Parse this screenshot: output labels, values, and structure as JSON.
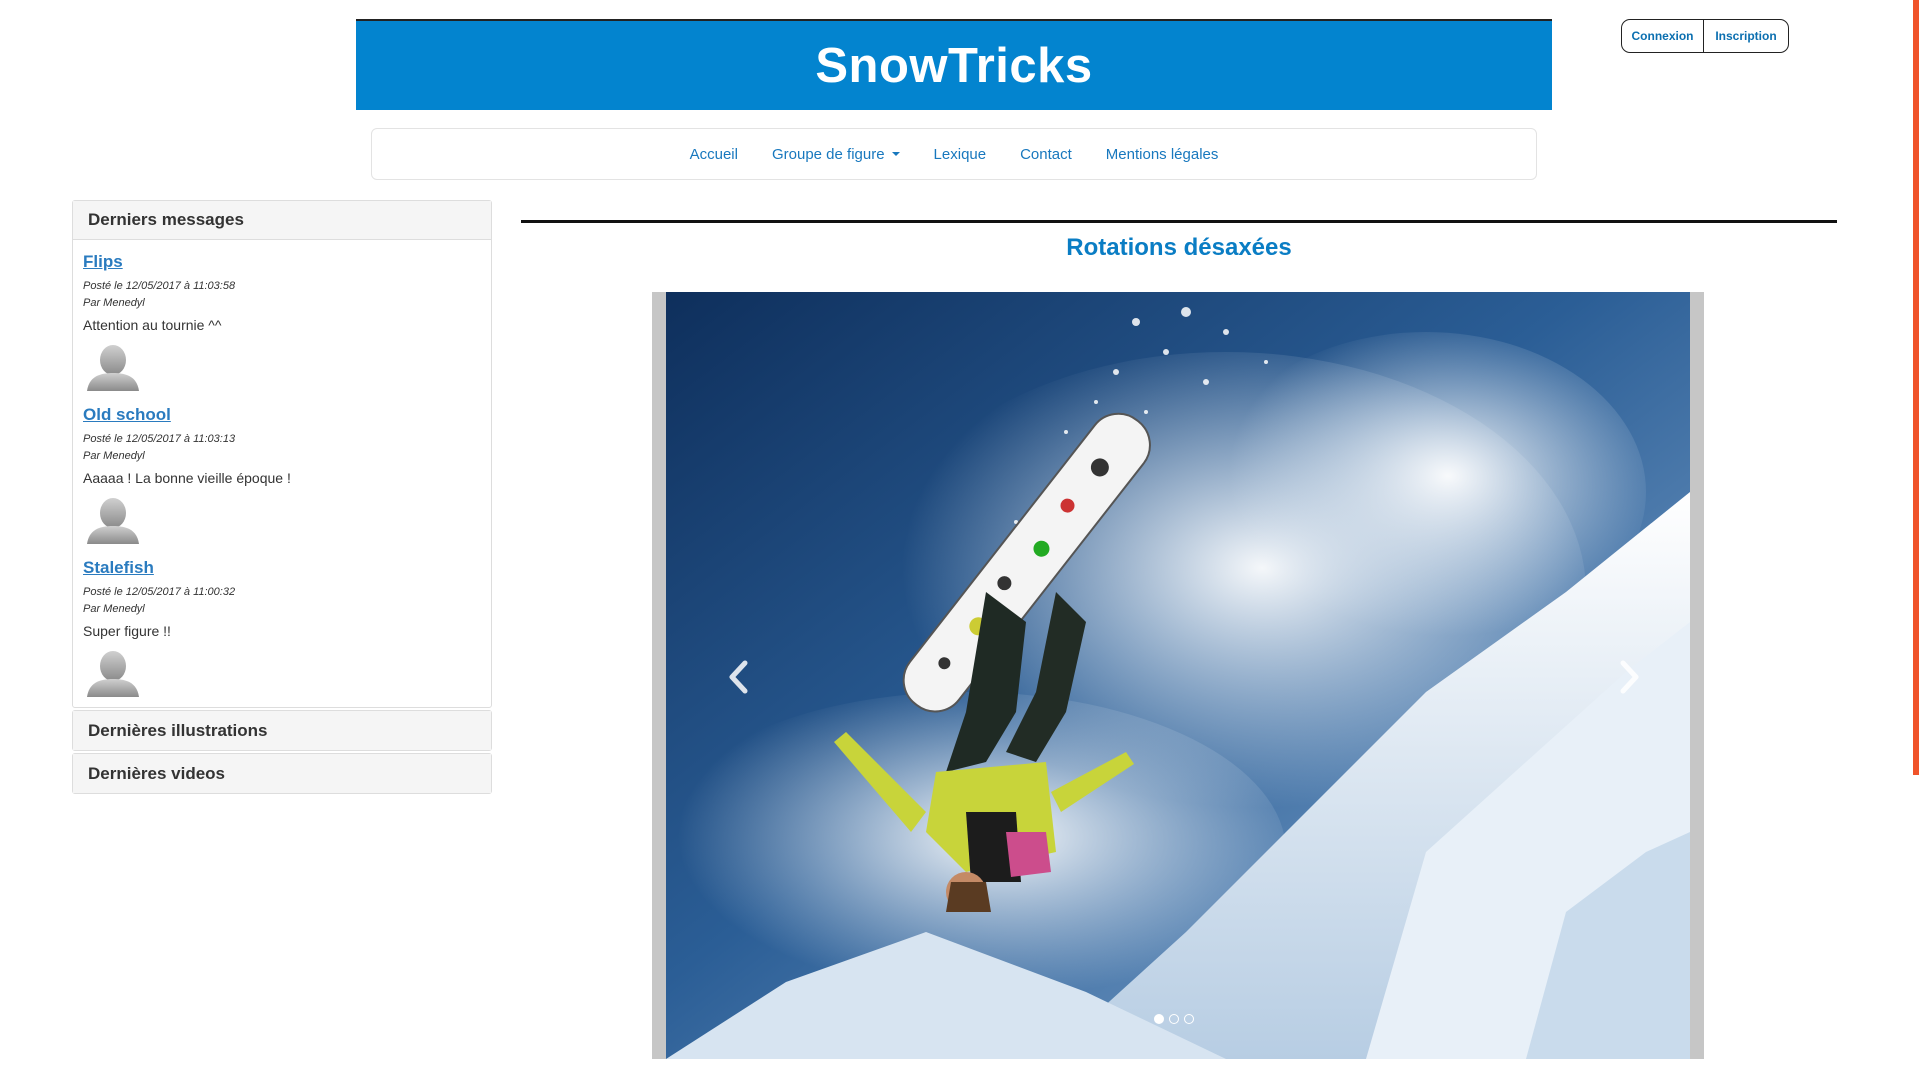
{
  "site": {
    "title": "SnowTricks"
  },
  "auth": {
    "login": "Connexion",
    "signup": "Inscription"
  },
  "nav": {
    "items": [
      {
        "label": "Accueil"
      },
      {
        "label": "Groupe de figure"
      },
      {
        "label": "Lexique"
      },
      {
        "label": "Contact"
      },
      {
        "label": "Mentions légales"
      }
    ]
  },
  "sidebar": {
    "messages_heading": "Derniers messages",
    "messages": [
      {
        "title": "Flips",
        "date": "Posté le 12/05/2017 à 11:03:58",
        "author": "Par Menedyl",
        "text": "Attention au tournie ^^"
      },
      {
        "title": "Old school",
        "date": "Posté le 12/05/2017 à 11:03:13",
        "author": "Par Menedyl",
        "text": "Aaaaa ! La bonne vieille époque !"
      },
      {
        "title": "Stalefish",
        "date": "Posté le 12/05/2017 à 11:00:32",
        "author": "Par Menedyl",
        "text": "Super figure !!"
      }
    ],
    "illustrations_heading": "Dernières illustrations",
    "videos_heading": "Dernières videos"
  },
  "main": {
    "trick_title": "Rotations désaxées",
    "carousel": {
      "slide_count": 3,
      "active_slide": 1
    }
  },
  "colors": {
    "brand": "#0384cf",
    "link": "#2a7bbf",
    "scroll_thumb": "#f0542a"
  }
}
